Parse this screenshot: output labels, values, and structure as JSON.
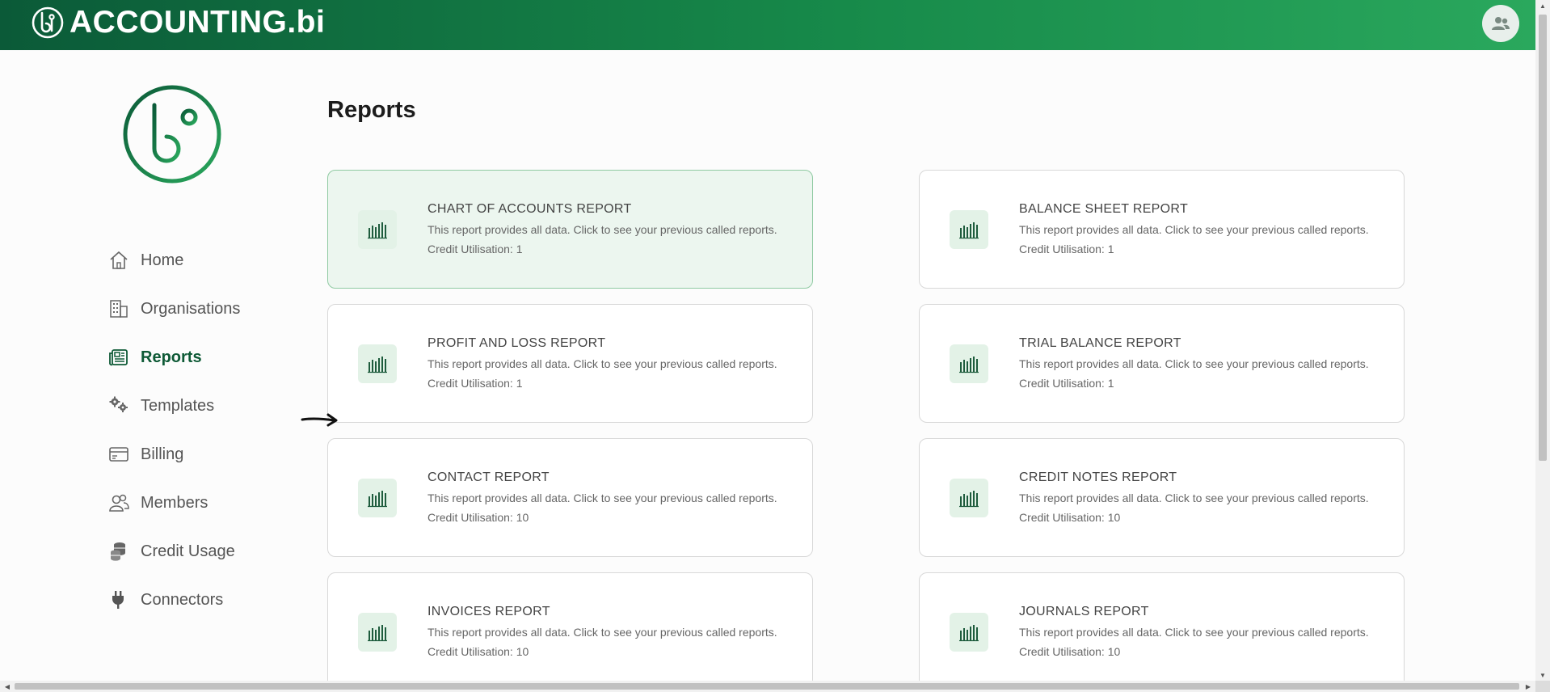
{
  "app": {
    "brand": "ACCOUNTING.bi",
    "brand_color": "#0b5a38",
    "accent_color": "#2aa85d"
  },
  "header": {
    "user_icon": "users-icon"
  },
  "sidebar": {
    "items": [
      {
        "label": "Home",
        "icon": "home-icon",
        "active": false
      },
      {
        "label": "Organisations",
        "icon": "building-icon",
        "active": false
      },
      {
        "label": "Reports",
        "icon": "newspaper-icon",
        "active": true
      },
      {
        "label": "Templates",
        "icon": "gears-icon",
        "active": false
      },
      {
        "label": "Billing",
        "icon": "credit-card-icon",
        "active": false
      },
      {
        "label": "Members",
        "icon": "people-icon",
        "active": false
      },
      {
        "label": "Credit Usage",
        "icon": "coins-icon",
        "active": false
      },
      {
        "label": "Connectors",
        "icon": "plug-icon",
        "active": false
      }
    ]
  },
  "main": {
    "title": "Reports",
    "reports": [
      {
        "title": "CHART OF ACCOUNTS REPORT",
        "desc": "This report provides all data. Click to see your previous called reports.",
        "credit": "Credit Utilisation: 1",
        "icon": "bar-chart-icon",
        "highlighted": true
      },
      {
        "title": "BALANCE SHEET REPORT",
        "desc": "This report provides all data. Click to see your previous called reports.",
        "credit": "Credit Utilisation: 1",
        "icon": "bar-chart-icon",
        "highlighted": false
      },
      {
        "title": "PROFIT AND LOSS REPORT",
        "desc": "This report provides all data. Click to see your previous called reports.",
        "credit": "Credit Utilisation: 1",
        "icon": "bar-chart-icon",
        "highlighted": false
      },
      {
        "title": "TRIAL BALANCE REPORT",
        "desc": "This report provides all data. Click to see your previous called reports.",
        "credit": "Credit Utilisation: 1",
        "icon": "bar-chart-icon",
        "highlighted": false
      },
      {
        "title": "CONTACT REPORT",
        "desc": "This report provides all data. Click to see your previous called reports.",
        "credit": "Credit Utilisation: 10",
        "icon": "bar-chart-icon",
        "highlighted": false
      },
      {
        "title": "CREDIT NOTES REPORT",
        "desc": "This report provides all data. Click to see your previous called reports.",
        "credit": "Credit Utilisation: 10",
        "icon": "bar-chart-icon",
        "highlighted": false
      },
      {
        "title": "INVOICES REPORT",
        "desc": "This report provides all data. Click to see your previous called reports.",
        "credit": "Credit Utilisation: 10",
        "icon": "bar-chart-icon",
        "highlighted": false
      },
      {
        "title": "JOURNALS REPORT",
        "desc": "This report provides all data. Click to see your previous called reports.",
        "credit": "Credit Utilisation: 10",
        "icon": "bar-chart-icon",
        "highlighted": false
      }
    ]
  }
}
